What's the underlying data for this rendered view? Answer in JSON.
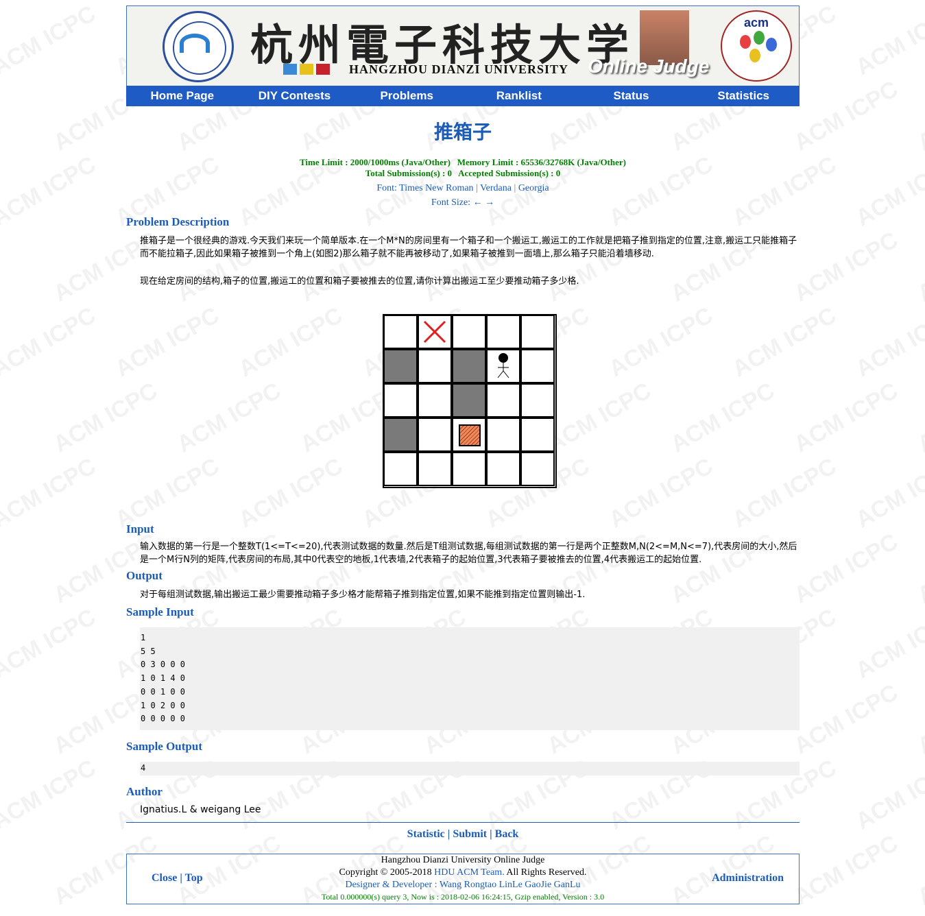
{
  "header": {
    "chinese_name": "杭州電子科技大学",
    "english_name": "HANGZHOU DIANZI UNIVERSITY",
    "oj_label": "Online Judge",
    "acm_label": "acm"
  },
  "nav": [
    "Home Page",
    "DIY Contests",
    "Problems",
    "Ranklist",
    "Status",
    "Statistics"
  ],
  "problem": {
    "title": "推箱子",
    "limits_line1": "Time Limit : 2000/1000ms (Java/Other)   Memory Limit : 65536/32768K (Java/Other)",
    "limits_line2": "Total Submission(s) : 0   Accepted Submission(s) : 0",
    "font_label": "Font:",
    "fonts": [
      "Times New Roman",
      "Verdana",
      "Georgia"
    ],
    "font_size_label": "Font Size:",
    "font_size_arrows": "← →",
    "desc_title": "Problem Description",
    "desc_p1": "推箱子是一个很经典的游戏.今天我们来玩一个简单版本.在一个M*N的房间里有一个箱子和一个搬运工,搬运工的工作就是把箱子推到指定的位置,注意,搬运工只能推箱子而不能拉箱子,因此如果箱子被推到一个角上(如图2)那么箱子就不能再被移动了,如果箱子被推到一面墙上,那么箱子只能沿着墙移动.",
    "desc_p2": "现在给定房间的结构,箱子的位置,搬运工的位置和箱子要被推去的位置,请你计算出搬运工至少要推动箱子多少格.",
    "grid": [
      [
        "empty",
        "target",
        "empty",
        "empty",
        "empty"
      ],
      [
        "wall",
        "empty",
        "wall",
        "porter",
        "empty"
      ],
      [
        "empty",
        "empty",
        "wall",
        "empty",
        "empty"
      ],
      [
        "wall",
        "empty",
        "box",
        "empty",
        "empty"
      ],
      [
        "empty",
        "empty",
        "empty",
        "empty",
        "empty"
      ]
    ],
    "input_title": "Input",
    "input_text": "输入数据的第一行是一个整数T(1<=T<=20),代表测试数据的数量.然后是T组测试数据,每组测试数据的第一行是两个正整数M,N(2<=M,N<=7),代表房间的大小,然后是一个M行N列的矩阵,代表房间的布局,其中0代表空的地板,1代表墙,2代表箱子的起始位置,3代表箱子要被推去的位置,4代表搬运工的起始位置.",
    "output_title": "Output",
    "output_text": "对于每组测试数据,输出搬运工最少需要推动箱子多少格才能帮箱子推到指定位置,如果不能推到指定位置则输出-1.",
    "sample_input_title": "Sample Input",
    "sample_input": [
      "1",
      "5 5",
      "0 3 0 0 0",
      "1 0 1 4 0",
      "0 0 1 0 0",
      "1 0 2 0 0",
      "0 0 0 0 0"
    ],
    "sample_output_title": "Sample Output",
    "sample_output": [
      "4"
    ],
    "author_title": "Author",
    "author": "Ignatius.L & weigang Lee"
  },
  "actions": {
    "statistic": "Statistic",
    "submit": "Submit",
    "back": "Back",
    "sep": "|"
  },
  "footer": {
    "close": "Close",
    "top": "Top",
    "line1": "Hangzhou Dianzi University Online Judge",
    "copyright_pre": "Copyright © 2005-2018",
    "team": "HDU ACM Team.",
    "copyright_post": "All Rights Reserved.",
    "designer_label": "Designer & Developer :",
    "designers": "Wang Rongtao LinLe GaoJie GanLu",
    "status_line": "Total 0.000000(s) query 3, Now is : 2018-02-06 16:24:15, Gzip enabled, Version : 3.0",
    "admin": "Administration"
  },
  "watermark": "ACM ICPC"
}
